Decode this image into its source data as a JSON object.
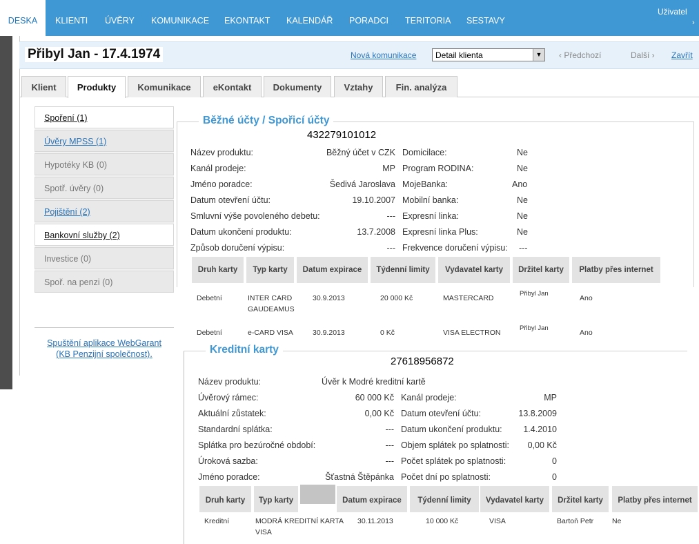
{
  "nav": {
    "items": [
      "DESKA",
      "KLIENTI",
      "ÚVĚRY",
      "KOMUNIKACE",
      "EKONTAKT",
      "KALENDÁŘ",
      "PORADCI",
      "TERITORIA",
      "SESTAVY"
    ],
    "user": "Uživatel",
    "user_arrow": "›"
  },
  "client": {
    "name": "Přibyl Jan - 17.4.1974",
    "new_comm": "Nová komunikace",
    "select_value": "Detail klienta",
    "prev": "‹ Předchozí",
    "next": "Další ›",
    "close": "Zavřít"
  },
  "tabs": [
    "Klient",
    "Produkty",
    "Komunikace",
    "eKontakt",
    "Dokumenty",
    "Vztahy",
    "Fin. analýza"
  ],
  "side_menu": [
    "Spoření (1)",
    "Úvěry MPSS (1)",
    "Hypotéky KB (0)",
    "Spotř. úvěry (0)",
    "Pojištění (2)",
    "Bankovní služby (2)",
    "Investice (0)",
    "Spoř. na penzi (0)"
  ],
  "webgarant": [
    "Spuštění aplikace WebGarant",
    "(KB Penzijní společnost)."
  ],
  "accounts": {
    "legend": "Běžné účty / Spořicí účty",
    "number": "432279101012",
    "left_labels": [
      "Název produktu:",
      "Kanál prodeje:",
      "Jméno poradce:",
      "Datum otevření účtu:",
      "Smluvní výše povoleného debetu:",
      "Datum ukončení produktu:",
      "Způsob doručení výpisu:"
    ],
    "left_values": [
      "Běžný účet v CZK",
      "MP",
      "Šedivá Jaroslava",
      "19.10.2007",
      "---",
      "13.7.2008",
      "---"
    ],
    "right_labels": [
      "Domicilace:",
      "Program RODINA:",
      "MojeBanka:",
      "Mobilní banka:",
      "Expresní linka:",
      "Expresní linka Plus:",
      "Frekvence doručení výpisu:"
    ],
    "right_values": [
      "Ne",
      "Ne",
      "Ano",
      "Ne",
      "Ne",
      "Ne",
      "---"
    ],
    "table_headers": [
      "Druh karty",
      "Typ karty",
      "Datum expirace",
      "Týdenní limity",
      "Vydavatel karty",
      "Držitel karty",
      "Platby přes internet"
    ],
    "rows": [
      [
        "Debetní",
        "INTER CARD GAUDEAMUS",
        "30.9.2013",
        "20 000 Kč",
        "MASTERCARD",
        "Přibyl Jan",
        "Ano"
      ],
      [
        "Debetní",
        "e-CARD VISA",
        "30.9.2013",
        "0 Kč",
        "VISA ELECTRON",
        "Přibyl Jan",
        "Ano"
      ]
    ]
  },
  "credit": {
    "legend": "Kreditní karty",
    "number": "27618956872",
    "product_label": "Název produktu:",
    "product_value": "Úvěr k Modré kreditní kartě",
    "left_labels": [
      "Úvěrový rámec:",
      "Aktuální zůstatek:",
      "Standardní splátka:",
      "Splátka pro bezúročné období:",
      "Úroková sazba:",
      "Jméno poradce:"
    ],
    "left_values": [
      "60 000 Kč",
      "0,00 Kč",
      "---",
      "---",
      "---",
      "Šťastná Štěpánka"
    ],
    "right_labels": [
      "Kanál prodeje:",
      "Datum otevření účtu:",
      "Datum ukončení produktu:",
      "Objem splátek po splatnosti:",
      "Počet splátek po splatnosti:",
      "Počet dní po splatnosti:"
    ],
    "right_values": [
      "MP",
      "13.8.2009",
      "1.4.2010",
      "0,00 Kč",
      "0",
      "0"
    ],
    "table_headers": [
      "Druh karty",
      "Typ karty",
      "Datum expirace",
      "Týdenní limity",
      "Vydavatel karty",
      "Držitel karty",
      "Platby přes internet"
    ],
    "row": [
      "Kreditní",
      "MODRÁ KREDITNÍ KARTA VISA",
      "30.11.2013",
      "10 000 Kč",
      "VISA",
      "Bartoň Petr",
      "Ne"
    ]
  }
}
